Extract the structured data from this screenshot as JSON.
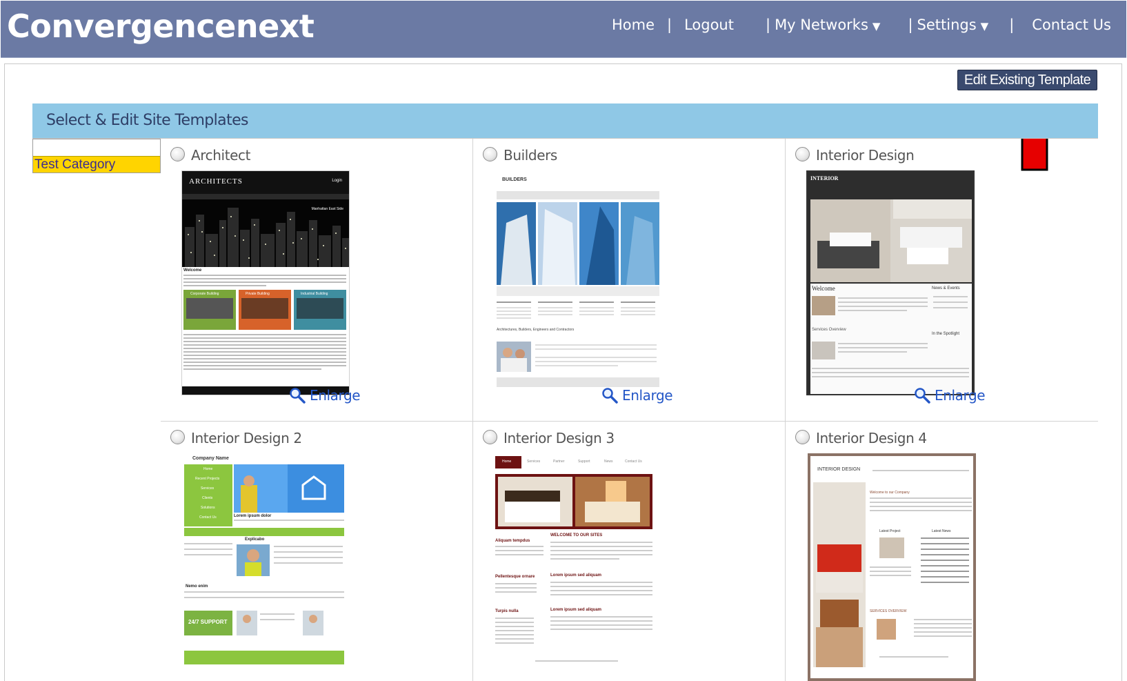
{
  "header": {
    "logo": "Convergencenext",
    "nav": {
      "home": "Home",
      "logout": "Logout",
      "my_networks": "My Networks",
      "settings": "Settings",
      "contact": "Contact Us",
      "separator": "|",
      "caret": "▼"
    }
  },
  "toolbar": {
    "edit_existing": "Edit Existing Template"
  },
  "section": {
    "title": "Select & Edit Site Templates"
  },
  "categories": [
    "Test Category"
  ],
  "enlarge_label": "Enlarge",
  "templates": [
    {
      "name": "Architect",
      "thumb_title": "ARCHITECTS",
      "thumb_login": "Login",
      "thumb_welcome": "Welcome",
      "thumb_tag": "Manhattan East Side",
      "thumb_cards": [
        "Corporate Building",
        "Private Building",
        "Industrial Building"
      ]
    },
    {
      "name": "Builders",
      "thumb_title": "BUILDERS",
      "thumb_sub": "Architectures, Builders, Engineers and Contractors"
    },
    {
      "name": "Interior Design",
      "thumb_title": "INTERIOR",
      "thumb_welcome": "Welcome",
      "thumb_news": "News & Events",
      "thumb_services": "Services Overview",
      "thumb_spotlight": "In the Spotlight"
    },
    {
      "name": "Interior Design 2",
      "thumb_title": "Company Name",
      "thumb_heading": "Lorem ipsum dolor",
      "thumb_explicabo": "Explicabo",
      "thumb_nemo": "Nemo enim",
      "thumb_support": "24/7 SUPPORT",
      "thumb_menu": [
        "Home",
        "Recent Projects",
        "Services",
        "Clients",
        "Solutions",
        "Contact Us"
      ]
    },
    {
      "name": "Interior Design 3",
      "thumb_tabs": [
        "Home",
        "Services",
        "Partner",
        "Support",
        "News",
        "Contact Us"
      ],
      "thumb_welcome": "WELCOME TO OUR SITES",
      "thumb_side": [
        "Aliquam tempdus",
        "Pellentesque ornare",
        "Turpis nulla"
      ],
      "thumb_lorem": "Lorem ipsum sed aliquam"
    },
    {
      "name": "Interior Design 4",
      "thumb_title": "INTERIOR DESIGN",
      "thumb_welcome": "Welcome to our Company",
      "thumb_latest_project": "Latest Project",
      "thumb_latest_news": "Latest News",
      "thumb_services": "SERVICES OVERVIEW"
    }
  ],
  "colors": {
    "header_bg": "#6b7aa4",
    "section_bar": "#8fc8e6",
    "category_highlight": "#ffd400",
    "button_bg": "#3a4a6e",
    "link": "#2457c7",
    "arrow": "#e60000"
  }
}
